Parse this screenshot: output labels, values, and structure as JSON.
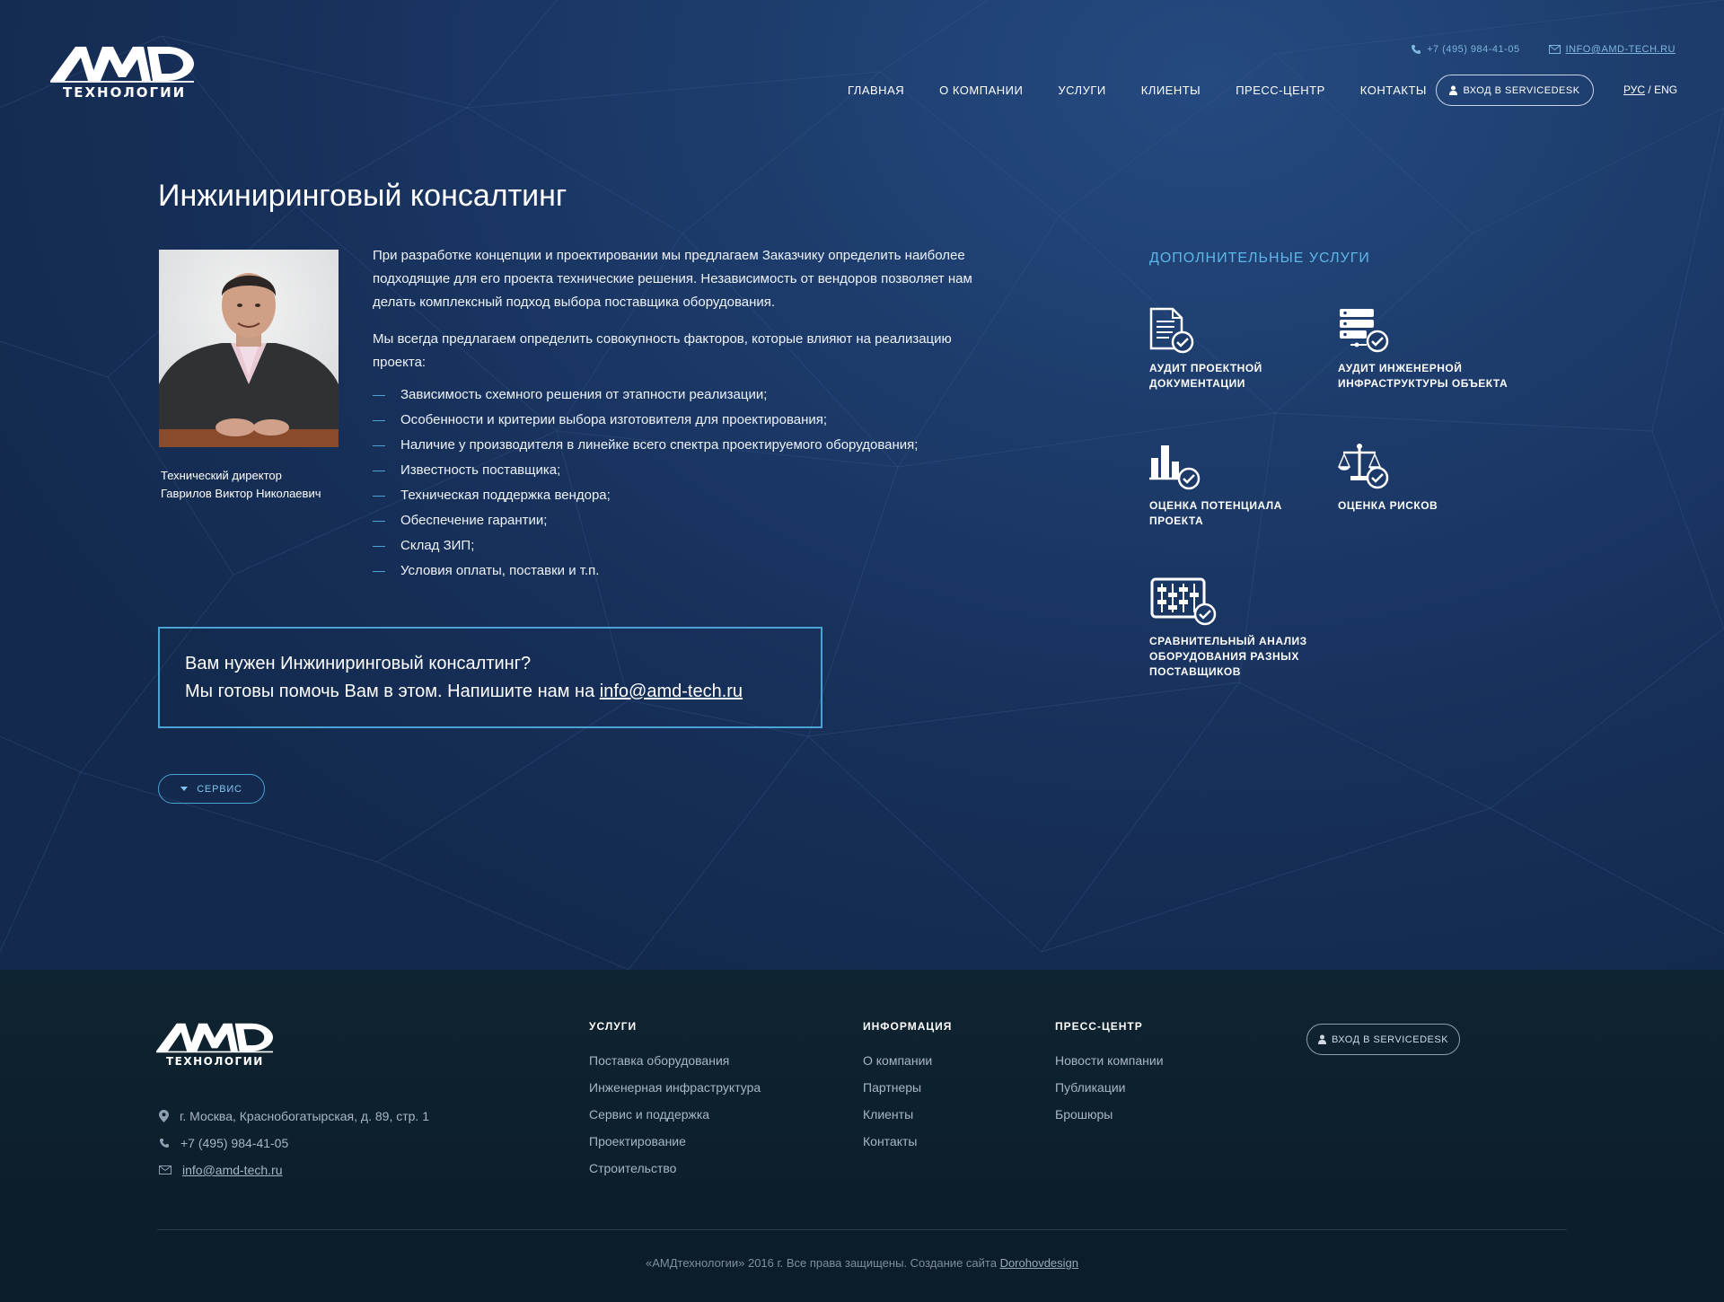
{
  "header": {
    "logo_text": "AMD",
    "logo_sub": "ТЕХНОЛОГИИ",
    "phone": "+7 (495) 984-41-05",
    "email": "INFO@AMD-TECH.RU",
    "nav": [
      "ГЛАВНАЯ",
      "О КОМПАНИИ",
      "УСЛУГИ",
      "КЛИЕНТЫ",
      "ПРЕСС-ЦЕНТР",
      "КОНТАКТЫ"
    ],
    "servicedesk": "ВХОД В SERVICEDESK",
    "lang_ru": "РУС",
    "lang_sep": "/",
    "lang_en": "ENG"
  },
  "main": {
    "title": "Инжиниринговый консалтинг",
    "caption_role": "Технический директор",
    "caption_name": "Гаврилов Виктор Николаевич",
    "paragraph1": "При разработке концепции и проектировании мы предлагаем Заказчику определить наиболее подходящие для его проекта технические решения. Независимость от вендоров позволяет нам делать комплексный подход выбора поставщика оборудования.",
    "paragraph2": "Мы всегда предлагаем определить совокупность факторов, которые влияют на реализацию проекта:",
    "factors": [
      "Зависимость схемного решения от этапности реализации;",
      "Особенности и критерии выбора изготовителя для проектирования;",
      "Наличие у производителя в линейке всего спектра проектируемого оборудования;",
      "Известность поставщика;",
      "Техническая поддержка вендора;",
      "Обеспечение гарантии;",
      "Склад ЗИП;",
      "Условия оплаты, поставки и т.п."
    ],
    "cta_line1": "Вам нужен Инжиниринговый консалтинг?",
    "cta_line2": "Мы готовы помочь Вам в этом. Напишите нам на",
    "cta_email": "info@amd-tech.ru",
    "service_button": "СЕРВИС"
  },
  "additional": {
    "title": "ДОПОЛНИТЕЛЬНЫЕ УСЛУГИ",
    "items": [
      {
        "l1": "АУДИТ ПРОЕКТНОЙ",
        "l2": "ДОКУМЕНТАЦИИ",
        "l3": "",
        "icon": "document-check-icon"
      },
      {
        "l1": "АУДИТ ИНЖЕНЕРНОЙ",
        "l2": "ИНФРАСТРУКТУРЫ ОБЪЕКТА",
        "l3": "",
        "icon": "server-check-icon"
      },
      {
        "l1": "ОЦЕНКА ПОТЕНЦИАЛА",
        "l2": "ПРОЕКТА",
        "l3": "",
        "icon": "bar-chart-check-icon"
      },
      {
        "l1": "ОЦЕНКА РИСКОВ",
        "l2": "",
        "l3": "",
        "icon": "scales-check-icon"
      },
      {
        "l1": "СРАВНИТЕЛЬНЫЙ АНАЛИЗ",
        "l2": "ОБОРУДОВАНИЯ РАЗНЫХ",
        "l3": "ПОСТАВЩИКОВ",
        "icon": "abacus-check-icon"
      }
    ]
  },
  "footer": {
    "address": "г. Москва, Краснобогатырская, д. 89, стр. 1",
    "phone": "+7 (495) 984-41-05",
    "email": "info@amd-tech.ru",
    "col_services_title": "УСЛУГИ",
    "col_services": [
      "Поставка оборудования",
      "Инженерная инфраструктура",
      "Сервис и поддержка",
      "Проектирование",
      "Строительство"
    ],
    "col_info_title": "ИНФОРМАЦИЯ",
    "col_info": [
      "О компании",
      "Партнеры",
      "Клиенты",
      "Контакты"
    ],
    "col_press_title": "ПРЕСС-ЦЕНТР",
    "col_press": [
      "Новости компании",
      "Публикации",
      "Брошюры"
    ],
    "servicedesk": "ВХОД В SERVICEDESK",
    "copyright": "«АМДтехнологии» 2016 г. Все права защищены. Создание сайта",
    "designer": "Dorohovdesign"
  },
  "colors": {
    "accent": "#4aa3d2",
    "accent_text": "#5eb7e8",
    "top_bg": "#1d3c6c",
    "footer_bg": "#0d1f2c"
  }
}
